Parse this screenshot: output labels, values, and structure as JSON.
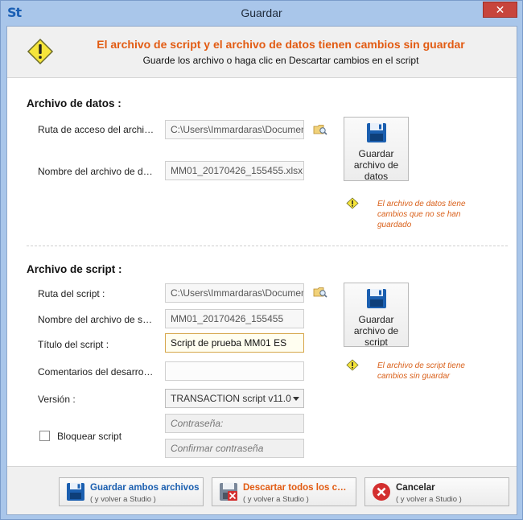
{
  "window": {
    "title": "Guardar",
    "app_icon_text": "St",
    "close_glyph": "✕"
  },
  "header": {
    "title": "El archivo de script y el archivo de datos tienen cambios sin guardar",
    "subtitle": "Guarde los archivo o haga clic en Descartar cambios en el script"
  },
  "data_file": {
    "section_title": "Archivo de datos :",
    "path_label": "Ruta de acceso del archivo de datos :",
    "path_value": "C:\\Users\\Immardaras\\Documents",
    "name_label": "Nombre del archivo de datos :",
    "name_value": "MM01_20170426_155455.xlsx",
    "save_button_label": "Guardar archivo de datos",
    "warning": "El archivo de datos tiene cambios que no se han guardado"
  },
  "script_file": {
    "section_title": "Archivo de script :",
    "path_label": "Ruta del script :",
    "path_value": "C:\\Users\\Immardaras\\Documents",
    "name_label": "Nombre del archivo de script :",
    "name_value": "MM01_20170426_155455",
    "title_label": "Título del script :",
    "title_value": "Script de prueba MM01 ES",
    "comments_label": "Comentarios del desarrollador :",
    "comments_value": "",
    "version_label": "Versión :",
    "version_value": "TRANSACTION script v11.0",
    "lock_label": "Bloquear script",
    "password_placeholder": "Contraseña:",
    "confirm_placeholder": "Confirmar contraseña",
    "save_button_label": "Guardar archivo de script",
    "warning": "El archivo de script tiene cambios sin guardar"
  },
  "footer": {
    "save_both_label": "Guardar ambos archivos",
    "save_both_sub": "( y volver a Studio )",
    "discard_label": "Descartar todos los cambios",
    "discard_sub": "( y volver a Studio )",
    "cancel_label": "Cancelar",
    "cancel_sub": "( y volver a Studio )"
  },
  "colors": {
    "accent_orange": "#e25b12",
    "title_bar": "#a9c6ea",
    "save_blue": "#1b5fb0",
    "discard_red": "#d32f2f"
  },
  "icons": {
    "header": "warning-triangle-icon",
    "save": "floppy-disk-icon",
    "browse": "folder-search-icon",
    "discard": "floppy-disk-delete-icon",
    "cancel": "cancel-x-icon"
  }
}
